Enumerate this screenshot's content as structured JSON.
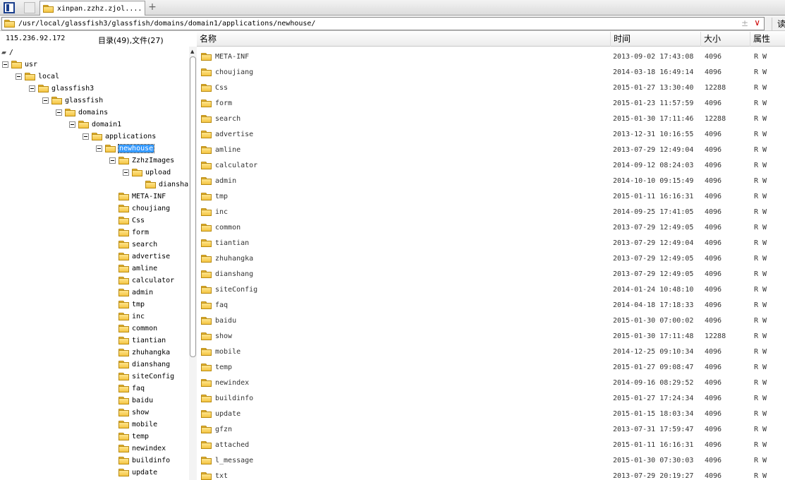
{
  "tabbar": {
    "panel_icon": "panel-toggle-icon",
    "active_tab": "xinpan.zzhz.zjol....",
    "add_label": "+"
  },
  "address": {
    "path": "/usr/local/glassfish3/glassfish/domains/domain1/applications/newhouse/",
    "plus": "±",
    "drop": "∨",
    "read_label": "读"
  },
  "info": {
    "ip": "115.236.92.172",
    "counts": "目录(49),文件(27)"
  },
  "columns": {
    "name": "名称",
    "time": "时间",
    "size": "大小",
    "attr": "属性"
  },
  "tree": {
    "root": "/",
    "nodes": [
      {
        "label": "usr",
        "level": 0,
        "expanded": true
      },
      {
        "label": "local",
        "level": 1,
        "expanded": true
      },
      {
        "label": "glassfish3",
        "level": 2,
        "expanded": true
      },
      {
        "label": "glassfish",
        "level": 3,
        "expanded": true
      },
      {
        "label": "domains",
        "level": 4,
        "expanded": true
      },
      {
        "label": "domain1",
        "level": 5,
        "expanded": true
      },
      {
        "label": "applications",
        "level": 6,
        "expanded": true
      },
      {
        "label": "newhouse",
        "level": 7,
        "expanded": true,
        "selected": true
      },
      {
        "label": "ZzhzImages",
        "level": 8,
        "expanded": true
      },
      {
        "label": "upload",
        "level": 9,
        "expanded": true
      },
      {
        "label": "dianshang",
        "level": 10,
        "expanded": false
      },
      {
        "label": "META-INF",
        "level": 8,
        "expanded": false
      },
      {
        "label": "choujiang",
        "level": 8,
        "expanded": false
      },
      {
        "label": "Css",
        "level": 8,
        "expanded": false
      },
      {
        "label": "form",
        "level": 8,
        "expanded": false
      },
      {
        "label": "search",
        "level": 8,
        "expanded": false
      },
      {
        "label": "advertise",
        "level": 8,
        "expanded": false
      },
      {
        "label": "amline",
        "level": 8,
        "expanded": false
      },
      {
        "label": "calculator",
        "level": 8,
        "expanded": false
      },
      {
        "label": "admin",
        "level": 8,
        "expanded": false
      },
      {
        "label": "tmp",
        "level": 8,
        "expanded": false
      },
      {
        "label": "inc",
        "level": 8,
        "expanded": false
      },
      {
        "label": "common",
        "level": 8,
        "expanded": false
      },
      {
        "label": "tiantian",
        "level": 8,
        "expanded": false
      },
      {
        "label": "zhuhangka",
        "level": 8,
        "expanded": false
      },
      {
        "label": "dianshang",
        "level": 8,
        "expanded": false
      },
      {
        "label": "siteConfig",
        "level": 8,
        "expanded": false
      },
      {
        "label": "faq",
        "level": 8,
        "expanded": false
      },
      {
        "label": "baidu",
        "level": 8,
        "expanded": false
      },
      {
        "label": "show",
        "level": 8,
        "expanded": false
      },
      {
        "label": "mobile",
        "level": 8,
        "expanded": false
      },
      {
        "label": "temp",
        "level": 8,
        "expanded": false
      },
      {
        "label": "newindex",
        "level": 8,
        "expanded": false
      },
      {
        "label": "buildinfo",
        "level": 8,
        "expanded": false
      },
      {
        "label": "update",
        "level": 8,
        "expanded": false
      }
    ]
  },
  "files": [
    {
      "name": "META-INF",
      "time": "2013-09-02 17:43:08",
      "size": "4096",
      "attr": "R W"
    },
    {
      "name": "choujiang",
      "time": "2014-03-18 16:49:14",
      "size": "4096",
      "attr": "R W"
    },
    {
      "name": "Css",
      "time": "2015-01-27 13:30:40",
      "size": "12288",
      "attr": "R W"
    },
    {
      "name": "form",
      "time": "2015-01-23 11:57:59",
      "size": "4096",
      "attr": "R W"
    },
    {
      "name": "search",
      "time": "2015-01-30 17:11:46",
      "size": "12288",
      "attr": "R W"
    },
    {
      "name": "advertise",
      "time": "2013-12-31 10:16:55",
      "size": "4096",
      "attr": "R W"
    },
    {
      "name": "amline",
      "time": "2013-07-29 12:49:04",
      "size": "4096",
      "attr": "R W"
    },
    {
      "name": "calculator",
      "time": "2014-09-12 08:24:03",
      "size": "4096",
      "attr": "R W"
    },
    {
      "name": "admin",
      "time": "2014-10-10 09:15:49",
      "size": "4096",
      "attr": "R W"
    },
    {
      "name": "tmp",
      "time": "2015-01-11 16:16:31",
      "size": "4096",
      "attr": "R W"
    },
    {
      "name": "inc",
      "time": "2014-09-25 17:41:05",
      "size": "4096",
      "attr": "R W"
    },
    {
      "name": "common",
      "time": "2013-07-29 12:49:05",
      "size": "4096",
      "attr": "R W"
    },
    {
      "name": "tiantian",
      "time": "2013-07-29 12:49:04",
      "size": "4096",
      "attr": "R W"
    },
    {
      "name": "zhuhangka",
      "time": "2013-07-29 12:49:05",
      "size": "4096",
      "attr": "R W"
    },
    {
      "name": "dianshang",
      "time": "2013-07-29 12:49:05",
      "size": "4096",
      "attr": "R W"
    },
    {
      "name": "siteConfig",
      "time": "2014-01-24 10:48:10",
      "size": "4096",
      "attr": "R W"
    },
    {
      "name": "faq",
      "time": "2014-04-18 17:18:33",
      "size": "4096",
      "attr": "R W"
    },
    {
      "name": "baidu",
      "time": "2015-01-30 07:00:02",
      "size": "4096",
      "attr": "R W"
    },
    {
      "name": "show",
      "time": "2015-01-30 17:11:48",
      "size": "12288",
      "attr": "R W"
    },
    {
      "name": "mobile",
      "time": "2014-12-25 09:10:34",
      "size": "4096",
      "attr": "R W"
    },
    {
      "name": "temp",
      "time": "2015-01-27 09:08:47",
      "size": "4096",
      "attr": "R W"
    },
    {
      "name": "newindex",
      "time": "2014-09-16 08:29:52",
      "size": "4096",
      "attr": "R W"
    },
    {
      "name": "buildinfo",
      "time": "2015-01-27 17:24:34",
      "size": "4096",
      "attr": "R W"
    },
    {
      "name": "update",
      "time": "2015-01-15 18:03:34",
      "size": "4096",
      "attr": "R W"
    },
    {
      "name": "gfzn",
      "time": "2013-07-31 17:59:47",
      "size": "4096",
      "attr": "R W"
    },
    {
      "name": "attached",
      "time": "2015-01-11 16:16:31",
      "size": "4096",
      "attr": "R W"
    },
    {
      "name": "l_message",
      "time": "2015-01-30 07:30:03",
      "size": "4096",
      "attr": "R W"
    },
    {
      "name": "txt",
      "time": "2013-07-29 20:19:27",
      "size": "4096",
      "attr": "R W"
    }
  ]
}
